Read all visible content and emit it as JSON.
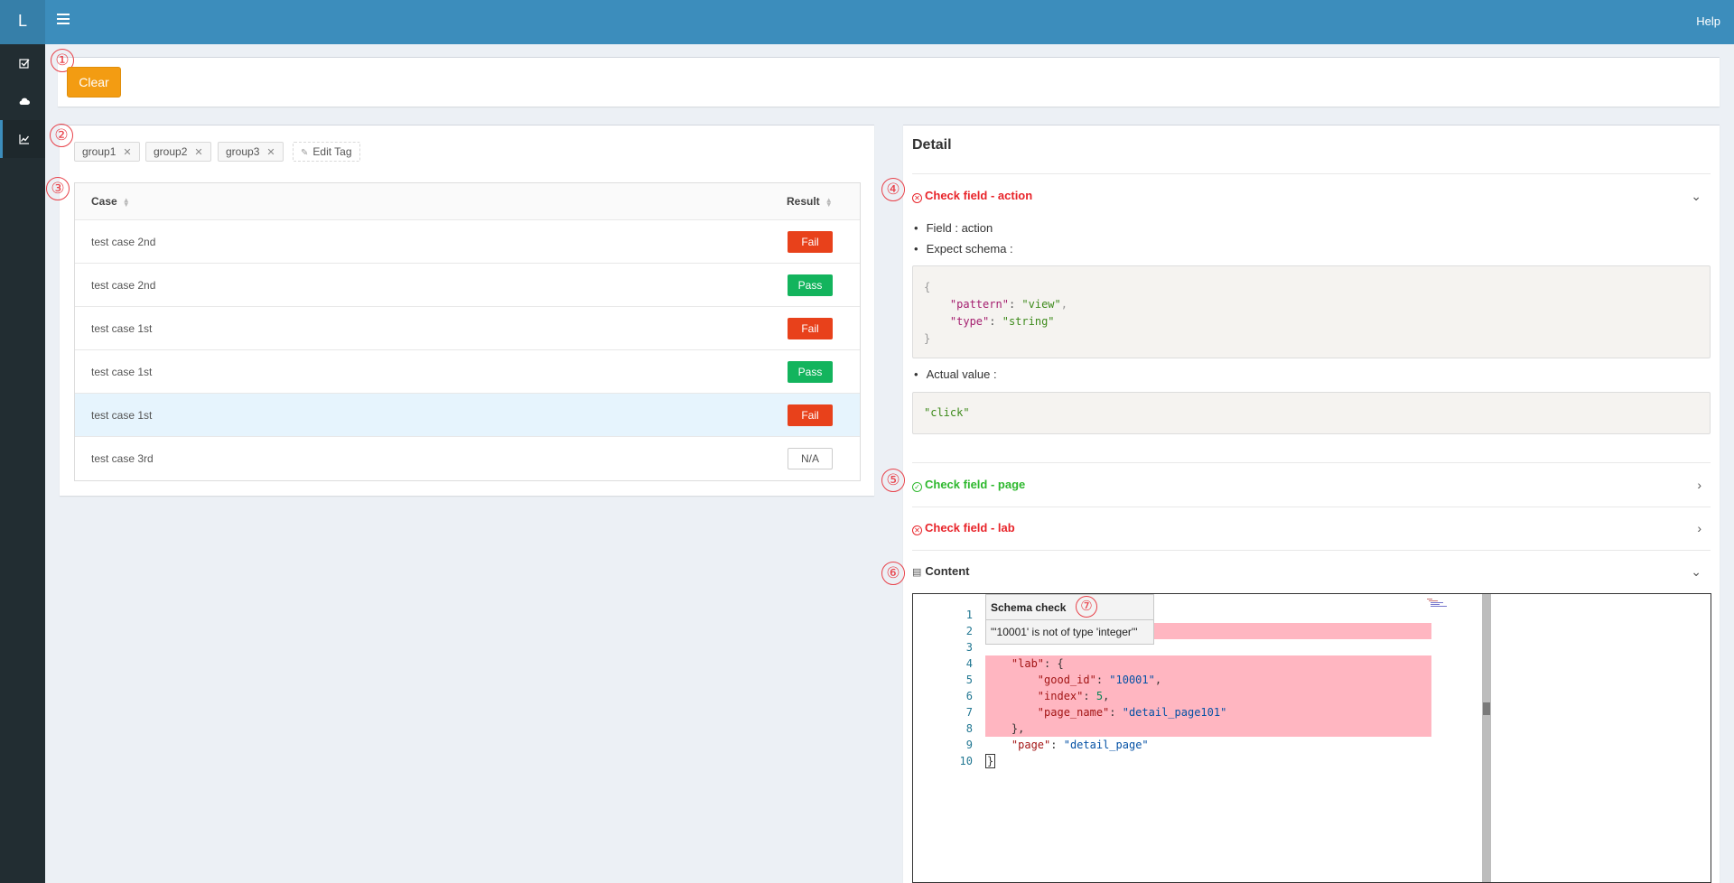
{
  "app": {
    "logo": "L",
    "help": "Help"
  },
  "toolbar": {
    "clear_label": "Clear"
  },
  "markers": [
    "①",
    "②",
    "③",
    "④",
    "⑤",
    "⑥",
    "⑦"
  ],
  "tags": [
    {
      "label": "group1"
    },
    {
      "label": "group2"
    },
    {
      "label": "group3"
    }
  ],
  "edit_tag_label": "Edit Tag",
  "table": {
    "headers": {
      "case": "Case",
      "result": "Result"
    },
    "rows": [
      {
        "case": "test case 2nd",
        "result": "Fail",
        "status": "fail"
      },
      {
        "case": "test case 2nd",
        "result": "Pass",
        "status": "pass"
      },
      {
        "case": "test case 1st",
        "result": "Fail",
        "status": "fail"
      },
      {
        "case": "test case 1st",
        "result": "Pass",
        "status": "pass"
      },
      {
        "case": "test case 1st",
        "result": "Fail",
        "status": "fail",
        "selected": true
      },
      {
        "case": "test case 3rd",
        "result": "N/A",
        "status": "na"
      }
    ]
  },
  "detail": {
    "title": "Detail",
    "sections": {
      "action": {
        "title": "Check field - action",
        "status": "fail"
      },
      "page": {
        "title": "Check field - page",
        "status": "pass"
      },
      "lab": {
        "title": "Check field - lab",
        "status": "fail"
      },
      "content": {
        "title": "Content"
      }
    },
    "field_label": "Field : action",
    "expect_label": "Expect schema :",
    "actual_label": "Actual value :",
    "schema": {
      "pattern_key": "\"pattern\"",
      "pattern_val": "\"view\"",
      "type_key": "\"type\"",
      "type_val": "\"string\""
    },
    "actual_value": "\"click\""
  },
  "editor": {
    "line_numbers": [
      "1",
      "2",
      "3",
      "4",
      "5",
      "6",
      "7",
      "8",
      "9",
      "10"
    ],
    "code": {
      "lab_key": "\"lab\"",
      "good_id_key": "\"good_id\"",
      "good_id_val": "\"10001\"",
      "index_key": "\"index\"",
      "index_val": "5",
      "page_name_key": "\"page_name\"",
      "page_name_val": "\"detail_page101\"",
      "page_key": "\"page\"",
      "page_val": "\"detail_page\""
    },
    "tooltip": {
      "title": "Schema check",
      "message": "\"'10001' is not of type 'integer'\""
    }
  },
  "colors": {
    "header": "#3c8dbc",
    "sidebar": "#222d32",
    "clear": "#f39c12",
    "fail": "#e8411b",
    "pass": "#13b45d",
    "error_highlight": "#ffb6c1"
  },
  "icons": [
    "menu-icon",
    "checkbox-icon",
    "cloud-icon",
    "chart-icon",
    "close-icon",
    "edit-icon",
    "sort-icon",
    "circle-x-icon",
    "circle-check-icon",
    "file-icon",
    "chevron-down-icon",
    "chevron-right-icon"
  ]
}
